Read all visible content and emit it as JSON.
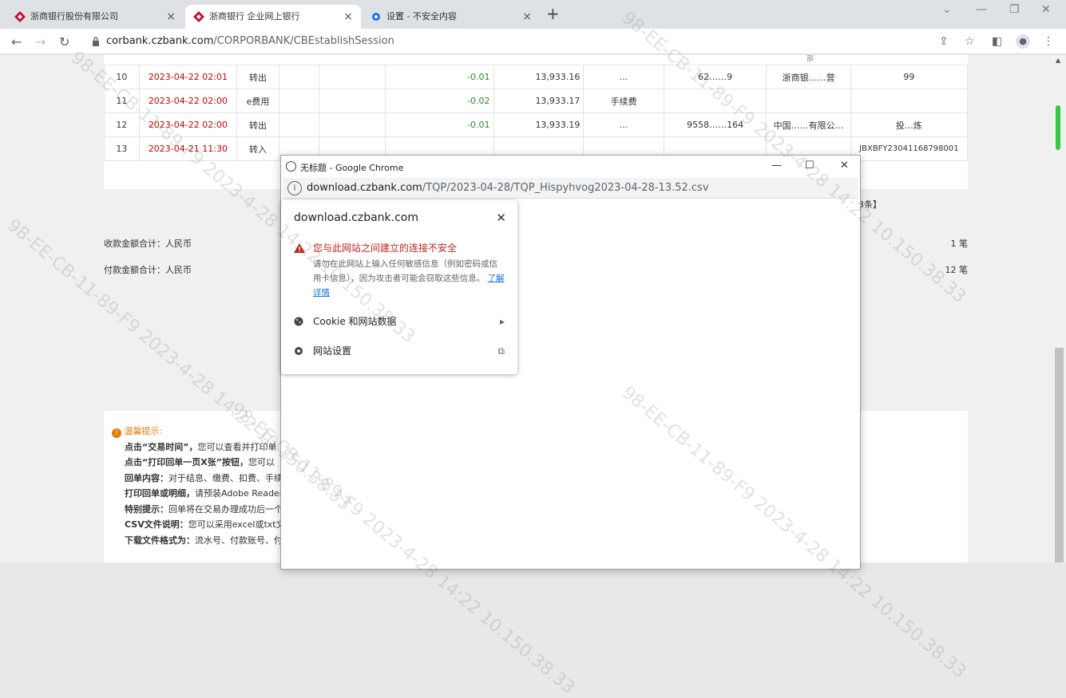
{
  "browser": {
    "tabs": [
      {
        "label": "浙商银行股份有限公司"
      },
      {
        "label": "浙商银行 企业网上银行"
      },
      {
        "label": "设置 - 不安全内容"
      }
    ],
    "url_host": "corbank.czbank.com",
    "url_path": "/CORPORBANK/CBEstablishSession"
  },
  "table": {
    "top_fragment": "部",
    "rows": [
      {
        "no": "10",
        "date": "2023-04-22 02:01",
        "type": "转出",
        "amount": "-0.01",
        "balance": "13,933.16",
        "memo": "…",
        "account": "62……9",
        "bank": "浙商银……营",
        "ref": "99"
      },
      {
        "no": "11",
        "date": "2023-04-22 02:00",
        "type": "e费用",
        "amount": "-0.02",
        "balance": "13,933.17",
        "memo": "手续费",
        "account": "",
        "bank": "",
        "ref": ""
      },
      {
        "no": "12",
        "date": "2023-04-22 02:00",
        "type": "转出",
        "amount": "-0.01",
        "balance": "13,933.19",
        "memo": "…",
        "account": "9558……164",
        "bank": "中国……有限公…",
        "ref": "投…炼"
      },
      {
        "no": "13",
        "date": "2023-04-21 11:30",
        "type": "转入",
        "amount": "",
        "balance": "",
        "memo": "",
        "account": "",
        "bank": "",
        "ref": "JBXBFY23041168798001"
      }
    ],
    "total_text": "3条】"
  },
  "summary": {
    "receipts_label": "收款金额合计：人民币",
    "receipts_count": "1 笔",
    "payments_label": "付款金额合计：人民币",
    "payments_count": "12 笔"
  },
  "tips": {
    "heading": "温馨提示:",
    "lines": [
      {
        "bold": "点击“交易时间”，",
        "text": "您可以查看并打印单"
      },
      {
        "bold": "点击“打印回单一页X张”按钮，",
        "text": "您可以"
      },
      {
        "bold": "回单内容：",
        "text": "对于结息、缴费、扣费、手续"
      },
      {
        "bold": "打印回单或明细，",
        "text": "请预装Adobe Reader"
      },
      {
        "bold": "特别提示：",
        "text": "回单将在交易办理成功后一个"
      },
      {
        "bold": "CSV文件说明：",
        "text": "您可以采用excel或txt文"
      },
      {
        "bold": "下载文件格式为：",
        "text": "流水号、付款账号、付"
      }
    ]
  },
  "popup": {
    "title": "无标题 - Google Chrome",
    "url_host": "download.czbank.com",
    "url_path": "/TQP/2023-04-28/TQP_Hispyhvog2023-04-28-13.52.csv",
    "info_host": "download.czbank.com",
    "warn_title": "您与此网站之间建立的连接不安全",
    "warn_body": "请勿在此网站上输入任何敏感信息（例如密码或信用卡信息），因为攻击者可能会窃取这些信息。",
    "learn_more": "了解详情",
    "cookie_label": "Cookie 和网站数据",
    "settings_label": "网站设置"
  },
  "watermark": "98-EE-CB-11-89-F9  2023-4-28 14:22  10.150.38.33",
  "colors": {
    "brand_red": "#c8102e",
    "negative_green": "#2e8b2e",
    "warning_red": "#c5221f",
    "link_blue": "#1a73e8",
    "tip_orange": "#e87c00"
  }
}
